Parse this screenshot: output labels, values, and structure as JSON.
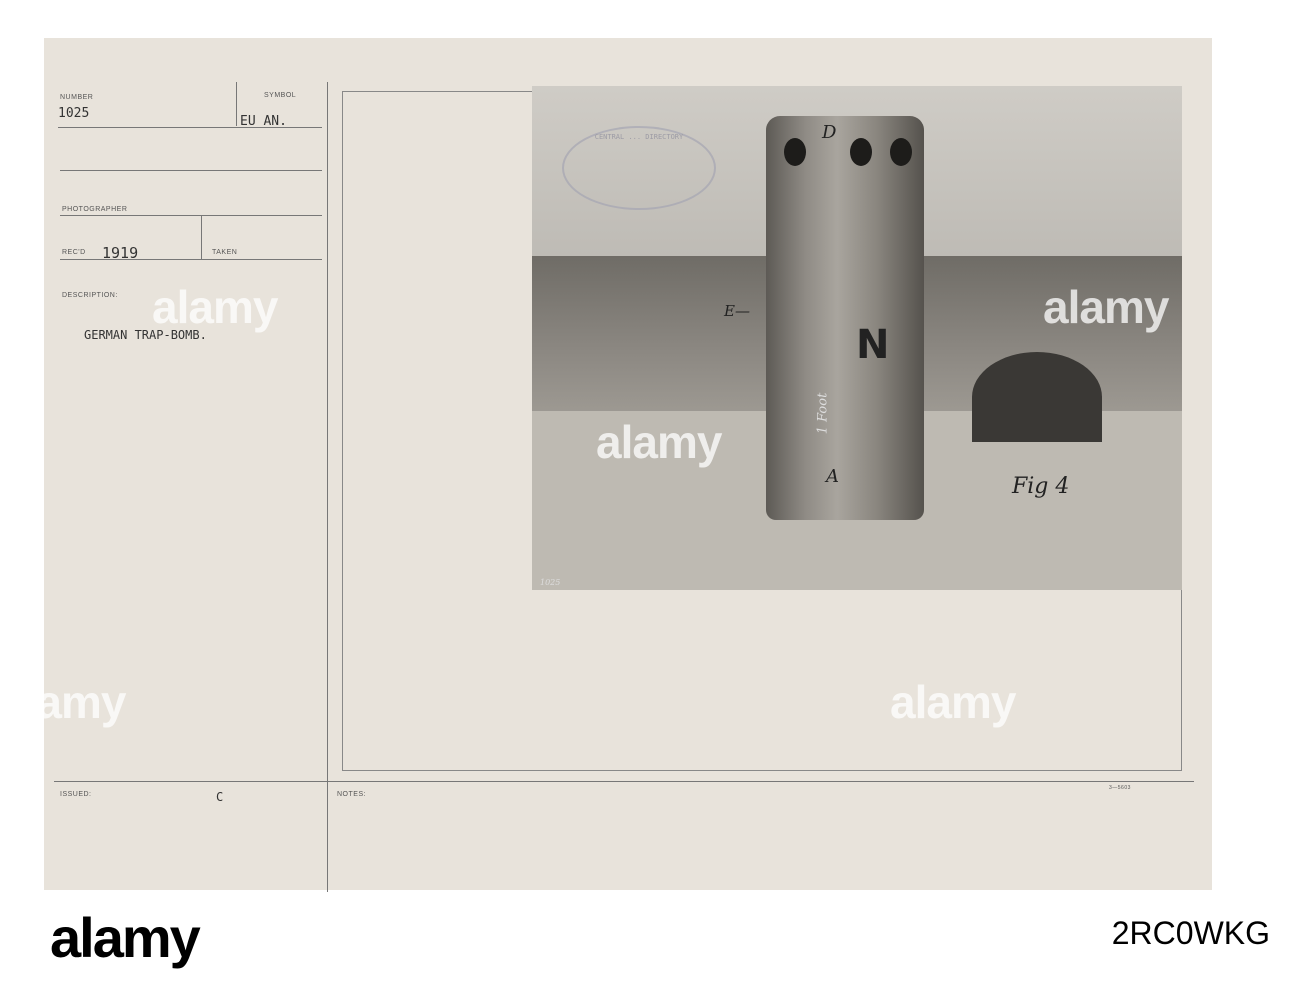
{
  "card": {
    "number_label": "NUMBER",
    "number": "1025",
    "symbol_label": "SYMBOL",
    "symbol": "EU AN.",
    "photographer_label": "PHOTOGRAPHER",
    "recd_label": "REC'D",
    "recd": "1919",
    "taken_label": "TAKEN",
    "description_label": "DESCRIPTION:",
    "description": "GERMAN TRAP-BOMB.",
    "issued_label": "ISSUED:",
    "issued": "C",
    "notes_label": "NOTES:",
    "form_number": "3—5603"
  },
  "photo": {
    "annotations": {
      "d": "D",
      "e": "E—",
      "n": "N",
      "foot": "1 Foot",
      "a": "A",
      "fig": "Fig 4",
      "corner": "1025"
    },
    "stamp": "CENTRAL ... DIRECTORY"
  },
  "watermark": "alamy",
  "footer": {
    "logo": "alamy",
    "image_id": "2RC0WKG"
  }
}
